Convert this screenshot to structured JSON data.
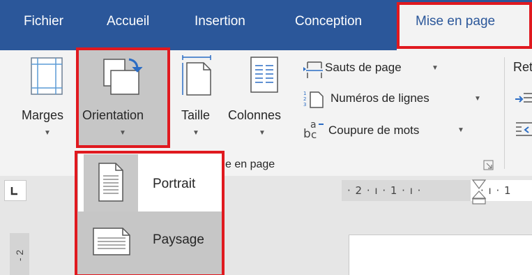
{
  "tabs": [
    "Fichier",
    "Accueil",
    "Insertion",
    "Conception"
  ],
  "active_tab": "Mise en page",
  "ribbon": {
    "marges": "Marges",
    "orientation": "Orientation",
    "taille": "Taille",
    "colonnes": "Colonnes",
    "sauts_de_page": "Sauts de page",
    "numeros_de_lignes": "Numéros de lignes",
    "coupure_de_mots": "Coupure de mots",
    "retrait_partial": "Ret",
    "group_label_partial": "e en page"
  },
  "dropdown": {
    "portrait": "Portrait",
    "paysage": "Paysage"
  },
  "ruler": {
    "ticks": "· 2 · ı · 1 · ı ·",
    "tail": "· ı · 1"
  },
  "vruler_label": "- 2",
  "colors": {
    "tab_bar": "#2b579a",
    "ribbon_bg": "#f3f3f3",
    "highlight": "#e0191f",
    "selected_gray": "#c6c6c6"
  }
}
